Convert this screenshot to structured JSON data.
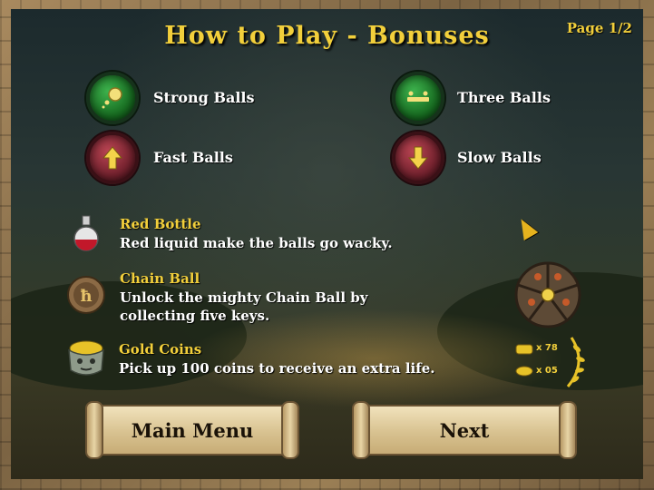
{
  "title": "How to Play - Bonuses",
  "page_indicator": "Page 1/2",
  "bonuses": [
    {
      "label": "Strong Balls",
      "icon": "strong-ball-icon",
      "color": "green"
    },
    {
      "label": "Three Balls",
      "icon": "three-balls-icon",
      "color": "green"
    },
    {
      "label": "Fast Balls",
      "icon": "up-arrow-icon",
      "color": "red"
    },
    {
      "label": "Slow Balls",
      "icon": "down-arrow-icon",
      "color": "red"
    }
  ],
  "items": [
    {
      "title": "Red Bottle",
      "desc_lines": [
        "Red liquid make the balls go wacky."
      ],
      "icon": "red-bottle-icon"
    },
    {
      "title": "Chain Ball",
      "desc_lines": [
        "Unlock the mighty Chain Ball by",
        "collecting five keys."
      ],
      "icon": "chain-ball-token-icon"
    },
    {
      "title": "Gold Coins",
      "desc_lines": [
        "Pick up 100 coins to receive an extra life."
      ],
      "icon": "gold-coins-pot-icon"
    }
  ],
  "hud": {
    "coins_count": "x 78",
    "lives_count": "x 05"
  },
  "buttons": {
    "main_menu": "Main Menu",
    "next": "Next"
  },
  "colors": {
    "accent_gold": "#f2cf3b",
    "green_orb": "#16691f",
    "red_orb": "#70202c"
  }
}
